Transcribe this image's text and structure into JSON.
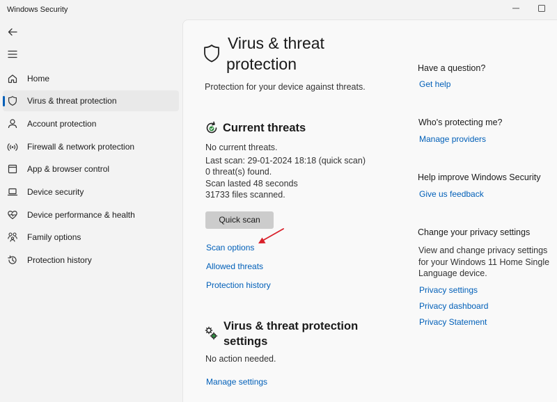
{
  "window": {
    "title": "Windows Security"
  },
  "sidebar": {
    "items": [
      {
        "label": "Home",
        "icon": "home-icon"
      },
      {
        "label": "Virus & threat protection",
        "icon": "shield-icon",
        "active": true
      },
      {
        "label": "Account protection",
        "icon": "person-icon"
      },
      {
        "label": "Firewall & network protection",
        "icon": "wifi-icon"
      },
      {
        "label": "App & browser control",
        "icon": "app-window-icon"
      },
      {
        "label": "Device security",
        "icon": "laptop-icon"
      },
      {
        "label": "Device performance & health",
        "icon": "heart-pulse-icon"
      },
      {
        "label": "Family options",
        "icon": "family-icon"
      },
      {
        "label": "Protection history",
        "icon": "history-icon"
      }
    ]
  },
  "main": {
    "title_line1": "Virus & threat",
    "title_line2": "protection",
    "subtitle": "Protection for your device against threats.",
    "current_threats": {
      "heading": "Current threats",
      "no_threats": "No current threats.",
      "last_scan": "Last scan: 29-01-2024 18:18 (quick scan)",
      "threats_found": "0 threat(s) found.",
      "scan_duration": "Scan lasted 48 seconds",
      "files_scanned": "31733 files scanned.",
      "quick_scan_button": "Quick scan",
      "scan_options_link": "Scan options",
      "allowed_threats_link": "Allowed threats",
      "protection_history_link": "Protection history"
    },
    "settings": {
      "heading_line1": "Virus & threat protection",
      "heading_line2": "settings",
      "status": "No action needed.",
      "manage_link": "Manage settings"
    }
  },
  "right_panel": {
    "question": {
      "heading": "Have a question?",
      "link": "Get help"
    },
    "protecting": {
      "heading": "Who's protecting me?",
      "link": "Manage providers"
    },
    "improve": {
      "heading": "Help improve Windows Security",
      "link": "Give us feedback"
    },
    "privacy": {
      "heading": "Change your privacy settings",
      "text_line1": "View and change privacy settings",
      "text_line2": "for your Windows 11 Home Single",
      "text_line3": "Language device.",
      "links": [
        "Privacy settings",
        "Privacy dashboard",
        "Privacy Statement"
      ]
    }
  },
  "colors": {
    "accent": "#005fb8",
    "annotation_arrow": "#d9202a",
    "status_green": "#2d8a3e"
  }
}
